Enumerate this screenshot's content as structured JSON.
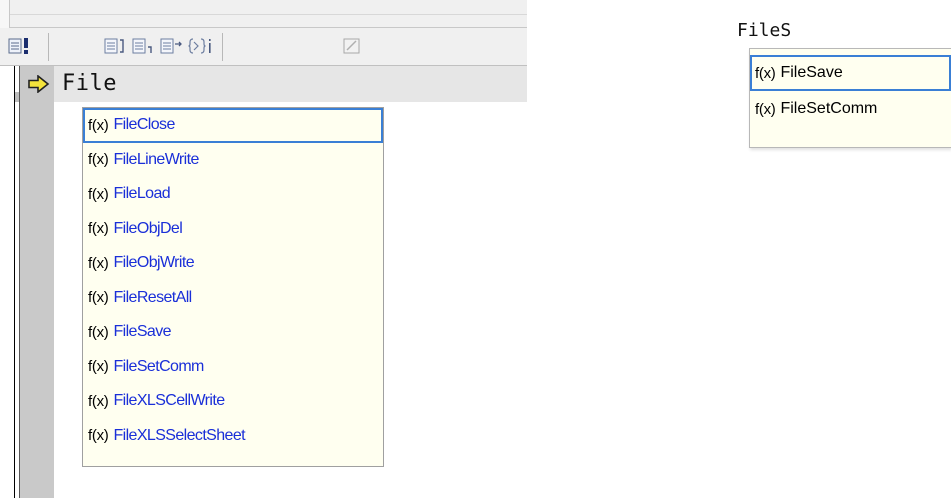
{
  "left_editor": {
    "typed_text": "File",
    "toolbar_icons": [
      "breakpoint-icon",
      "step-into-icon",
      "step-over-icon",
      "step-out-icon",
      "run-to-cursor-icon",
      "edit-icon"
    ],
    "completion": {
      "fx_label": "f(x)",
      "items": [
        {
          "label": "FileClose",
          "selected": true
        },
        {
          "label": "FileLineWrite",
          "selected": false
        },
        {
          "label": "FileLoad",
          "selected": false
        },
        {
          "label": "FileObjDel",
          "selected": false
        },
        {
          "label": "FileObjWrite",
          "selected": false
        },
        {
          "label": "FileResetAll",
          "selected": false
        },
        {
          "label": "FileSave",
          "selected": false
        },
        {
          "label": "FileSetComm",
          "selected": false
        },
        {
          "label": "FileXLSCellWrite",
          "selected": false
        },
        {
          "label": "FileXLSSelectSheet",
          "selected": false
        }
      ]
    }
  },
  "right_editor": {
    "typed_text": "FileS",
    "completion": {
      "fx_label": "f(x)",
      "items": [
        {
          "label": "FileSave",
          "selected": true
        },
        {
          "label": "FileSetComm",
          "selected": false
        }
      ]
    }
  },
  "colors": {
    "function_name": "#1a2fd8",
    "selection_border": "#3a7fd5",
    "popup_background": "#fffff0",
    "current_line_marker": "#f5e43c"
  }
}
